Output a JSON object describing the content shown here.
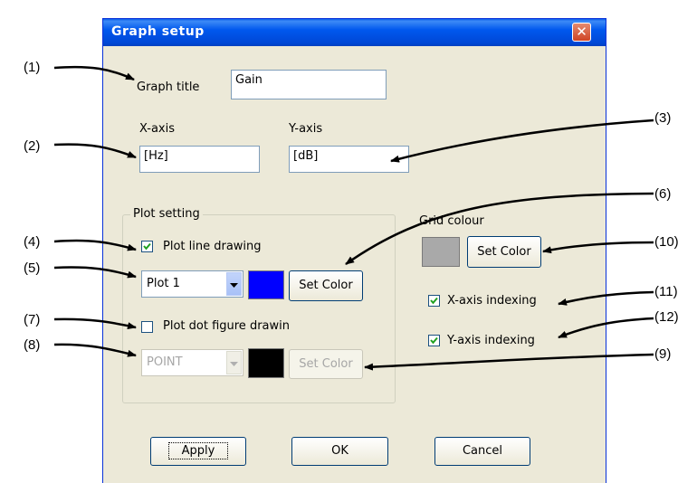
{
  "window": {
    "title": "Graph setup"
  },
  "fields": {
    "graph_title_label": "Graph title",
    "graph_title_value": "Gain",
    "x_axis_label": "X-axis",
    "x_axis_value": "[Hz]",
    "y_axis_label": "Y-axis",
    "y_axis_value": "[dB]"
  },
  "plot_setting": {
    "group_label": "Plot setting",
    "line_drawing": {
      "label": "Plot line drawing",
      "checked": true
    },
    "line_plot_select": "Plot 1",
    "line_color": "#0000ff",
    "set_color_label": "Set Color",
    "dot_drawing": {
      "label": "Plot dot figure drawin",
      "checked": false
    },
    "dot_select": "POINT",
    "dot_color": "#000000"
  },
  "grid": {
    "label": "Grid colour",
    "color": "#a9a9a9",
    "set_color_label": "Set Color",
    "x_indexing": {
      "label": "X-axis indexing",
      "checked": true
    },
    "y_indexing": {
      "label": "Y-axis indexing",
      "checked": true
    }
  },
  "buttons": {
    "apply": "Apply",
    "ok": "OK",
    "cancel": "Cancel"
  },
  "callouts": [
    "(1)",
    "(2)",
    "(3)",
    "(4)",
    "(5)",
    "(6)",
    "(7)",
    "(8)",
    "(9)",
    "(10)",
    "(11)",
    "(12)"
  ]
}
